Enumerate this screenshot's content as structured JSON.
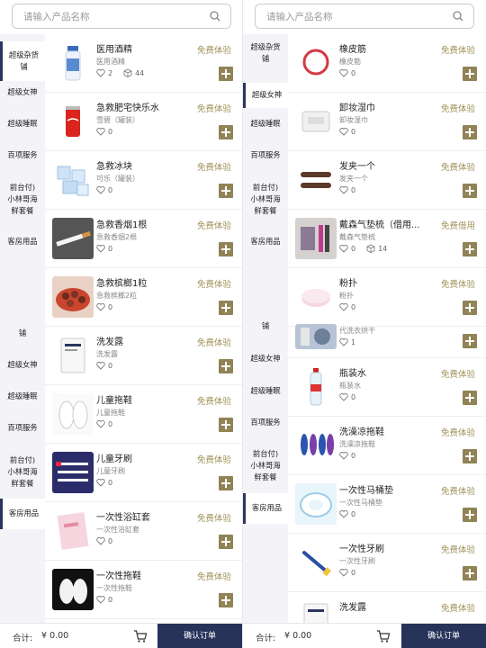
{
  "left": {
    "search_placeholder": "请输入产品名称",
    "sidebar": [
      {
        "label": "超级杂货\n铺",
        "active": true
      },
      {
        "label": "超级女神"
      },
      {
        "label": "超级睡眠"
      },
      {
        "label": "百项服务"
      },
      {
        "label": "前台付)\n小林哥海\n鲜套餐"
      },
      {
        "label": "客房用品"
      },
      {
        "label": "铺"
      },
      {
        "label": "超级女神"
      },
      {
        "label": "超级睡眠"
      },
      {
        "label": "百项服务"
      },
      {
        "label": "前台付)\n小林哥海\n鲜套餐"
      },
      {
        "label": "客房用品",
        "active": true
      }
    ],
    "products": [
      {
        "name": "医用酒精",
        "sub": "医用酒精",
        "likes": "2",
        "extra": "44",
        "tag": "免费体验"
      },
      {
        "name": "急救肥宅快乐水",
        "sub": "雪碧（罐装）",
        "likes": "0",
        "tag": "免费体验"
      },
      {
        "name": "急救冰块",
        "sub": "可乐（罐装）",
        "likes": "0",
        "tag": "免费体验"
      },
      {
        "name": "急救香烟1根",
        "sub": "急救香烟2根",
        "likes": "0",
        "tag": "免费体验"
      },
      {
        "name": "急救槟榔1粒",
        "sub": "急救槟榔2粒",
        "likes": "0",
        "tag": "免费体验"
      },
      {
        "name": "洗发露",
        "sub": "洗发露",
        "likes": "0",
        "tag": "免费体验"
      },
      {
        "name": "儿童拖鞋",
        "sub": "儿童拖鞋",
        "likes": "0",
        "tag": "免费体验"
      },
      {
        "name": "儿童牙刷",
        "sub": "儿童牙刷",
        "likes": "0",
        "tag": "免费体验"
      },
      {
        "name": "一次性浴缸套",
        "sub": "一次性浴缸套",
        "likes": "0",
        "tag": "免费体验"
      },
      {
        "name": "一次性拖鞋",
        "sub": "一次性拖鞋",
        "likes": "0",
        "tag": "免费体验"
      }
    ],
    "total_label": "合计:",
    "total_value": "¥ 0.00",
    "confirm_label": "确认订单"
  },
  "right": {
    "search_placeholder": "请输入产品名称",
    "sidebar": [
      {
        "label": "超级杂货\n铺"
      },
      {
        "label": "超级女神",
        "active": true
      },
      {
        "label": "超级睡眠"
      },
      {
        "label": "百项服务"
      },
      {
        "label": "前台付)\n小林哥海\n鲜套餐"
      },
      {
        "label": "客房用品"
      },
      {
        "label": "铺"
      },
      {
        "label": "超级女神"
      },
      {
        "label": "超级睡眠"
      },
      {
        "label": "百项服务"
      },
      {
        "label": "前台付)\n小林哥海\n鲜套餐"
      },
      {
        "label": "客房用品",
        "active": true
      }
    ],
    "products": [
      {
        "name": "橡皮筋",
        "sub": "橡皮筋",
        "likes": "0",
        "tag": "免费体验"
      },
      {
        "name": "卸妆湿巾",
        "sub": "卸妆湿巾",
        "likes": "0",
        "tag": "免费体验"
      },
      {
        "name": "发夹一个",
        "sub": "发夹一个",
        "likes": "0",
        "tag": "免费体验"
      },
      {
        "name": "戴森气垫梳（借用...",
        "sub": "戴森气垫梳",
        "likes": "0",
        "extra": "14",
        "tag": "免费借用"
      },
      {
        "name": "粉扑",
        "sub": "粉扑",
        "likes": "0",
        "tag": "免费体验"
      },
      {
        "name": "",
        "sub": "代洗衣烘干",
        "likes": "1",
        "tag": "免费体验"
      },
      {
        "name": "瓶装水",
        "sub": "瓶装水",
        "likes": "0",
        "tag": "免费体验"
      },
      {
        "name": "洗澡凉拖鞋",
        "sub": "洗澡凉拖鞋",
        "likes": "0",
        "tag": "免费体验"
      },
      {
        "name": "一次性马桶垫",
        "sub": "一次性马桶垫",
        "likes": "0",
        "tag": "免费体验"
      },
      {
        "name": "一次性牙刷",
        "sub": "一次性牙刷",
        "likes": "0",
        "tag": "免费体验"
      },
      {
        "name": "洗发露",
        "sub": "",
        "likes": "",
        "tag": "免费体验"
      }
    ],
    "total_label": "合计:",
    "total_value": "¥ 0.00",
    "confirm_label": "确认订单"
  }
}
